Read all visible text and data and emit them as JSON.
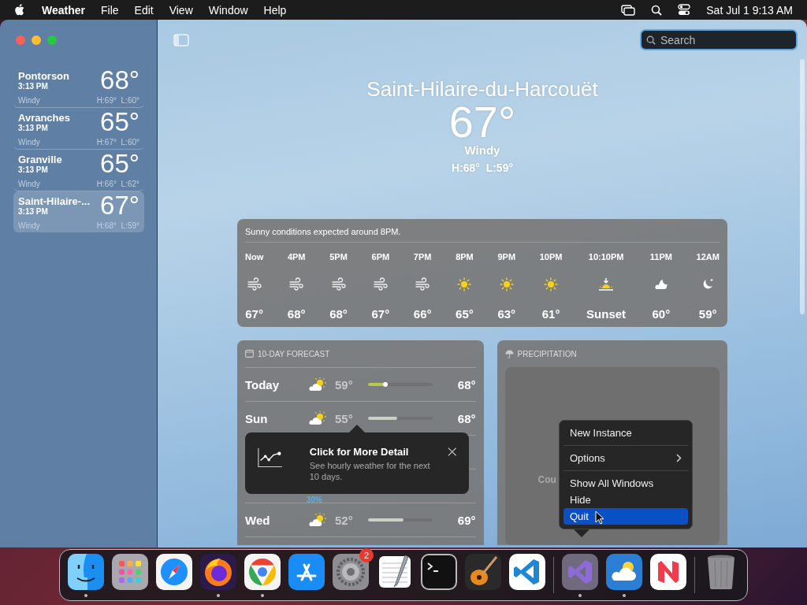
{
  "menu_bar": {
    "app_name": "Weather",
    "menus": [
      "File",
      "Edit",
      "View",
      "Window",
      "Help"
    ],
    "clock": "Sat Jul 1  9:13 AM"
  },
  "sidebar": {
    "locations": [
      {
        "name": "Pontorson",
        "time": "3:13 PM",
        "condition": "Windy",
        "temp": "68°",
        "high_low": "H:69°  L:60°",
        "selected": false
      },
      {
        "name": "Avranches",
        "time": "3:13 PM",
        "condition": "Windy",
        "temp": "65°",
        "high_low": "H:67°  L:60°",
        "selected": false
      },
      {
        "name": "Granville",
        "time": "3:13 PM",
        "condition": "Windy",
        "temp": "65°",
        "high_low": "H:66°  L:62°",
        "selected": false
      },
      {
        "name": "Saint-Hilaire-...",
        "time": "3:13 PM",
        "condition": "Windy",
        "temp": "67°",
        "high_low": "H:68°  L:59°",
        "selected": true
      }
    ]
  },
  "search": {
    "placeholder": "Search"
  },
  "current": {
    "city": "Saint-Hilaire-du-Harcouët",
    "temp": "67°",
    "condition": "Windy",
    "high_low": "H:68°  L:59°"
  },
  "hourly": {
    "summary": "Sunny conditions expected around 8PM.",
    "hours": [
      {
        "time": "Now",
        "kind": "wind",
        "temp": "67°"
      },
      {
        "time": "4PM",
        "kind": "wind",
        "temp": "68°"
      },
      {
        "time": "5PM",
        "kind": "wind",
        "temp": "68°"
      },
      {
        "time": "6PM",
        "kind": "wind",
        "temp": "67°"
      },
      {
        "time": "7PM",
        "kind": "wind",
        "temp": "66°"
      },
      {
        "time": "8PM",
        "kind": "sun",
        "temp": "65°"
      },
      {
        "time": "9PM",
        "kind": "sun",
        "temp": "63°"
      },
      {
        "time": "10PM",
        "kind": "sun",
        "temp": "61°"
      },
      {
        "time": "10:10PM",
        "kind": "sunset",
        "temp": "Sunset"
      },
      {
        "time": "11PM",
        "kind": "cloud-moon",
        "temp": "60°"
      },
      {
        "time": "12AM",
        "kind": "moon",
        "temp": "59°"
      }
    ]
  },
  "forecast": {
    "title": "10-DAY FORECAST",
    "days": [
      {
        "kind": "day",
        "day": "Today",
        "low": "59°",
        "level": 0.3,
        "high": "68°",
        "color": "#b8c84a",
        "now_marker": true
      },
      {
        "kind": "day",
        "day": "Sun",
        "low": "55°",
        "level": 0.45,
        "high": "68°",
        "color": "#cfd0c4",
        "now_marker": false
      },
      {
        "kind": "covered"
      },
      {
        "kind": "partial",
        "precip": "30%"
      },
      {
        "kind": "day",
        "day": "Wed",
        "low": "52°",
        "level": 0.55,
        "high": "69°",
        "color": "#cfd0c4",
        "now_marker": false
      }
    ]
  },
  "precipitation": {
    "title": "PRECIPITATION",
    "map_text": "Cou"
  },
  "tooltip": {
    "title": "Click for More Detail",
    "body": "See hourly weather for the next 10 days."
  },
  "dock_menu": {
    "items": [
      {
        "label": "New Instance",
        "submenu": false,
        "selected": false,
        "divider_after": true
      },
      {
        "label": "Options",
        "submenu": true,
        "selected": false,
        "divider_after": true
      },
      {
        "label": "Show All Windows",
        "submenu": false,
        "selected": false,
        "divider_after": false
      },
      {
        "label": "Hide",
        "submenu": false,
        "selected": false,
        "divider_after": false
      },
      {
        "label": "Quit",
        "submenu": false,
        "selected": true,
        "divider_after": false
      }
    ]
  },
  "dock": {
    "items": [
      {
        "kind": "finder",
        "running": true
      },
      {
        "kind": "launchpad",
        "running": false
      },
      {
        "kind": "safari",
        "running": false
      },
      {
        "kind": "firefox",
        "running": true
      },
      {
        "kind": "chrome",
        "running": true
      },
      {
        "kind": "appstore",
        "running": false
      },
      {
        "kind": "settings",
        "running": false,
        "badge": "2"
      },
      {
        "kind": "textedit",
        "running": false
      },
      {
        "kind": "terminal",
        "running": false
      },
      {
        "kind": "guitar",
        "running": false
      },
      {
        "kind": "vscode",
        "running": false
      },
      {
        "kind": "separator"
      },
      {
        "kind": "vs",
        "running": true
      },
      {
        "kind": "weather",
        "running": true
      },
      {
        "kind": "news",
        "running": false
      },
      {
        "kind": "separator"
      },
      {
        "kind": "trash",
        "running": false
      }
    ]
  }
}
